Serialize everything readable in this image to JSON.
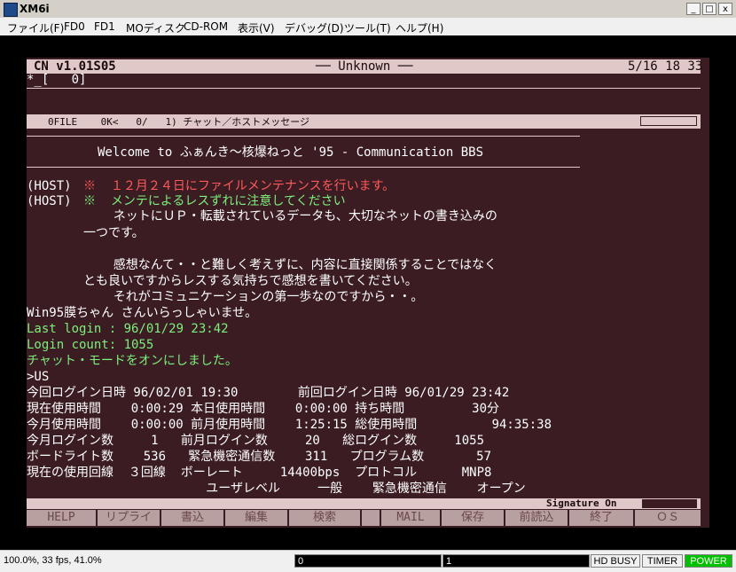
{
  "window": {
    "title": "XM6i",
    "min_label": "_",
    "max_label": "□",
    "close_label": "x"
  },
  "menu": [
    "ファイル(F)",
    "FD0",
    "FD1",
    "MOディスク",
    "CD-ROM",
    "表示(V)",
    "デバッグ(D)",
    "ツール(T)",
    "ヘルプ(H)"
  ],
  "term": {
    "header_left": "CN v1.01S05",
    "header_center": "── Unknown ──",
    "header_right": "5/16 18 33",
    "input_line": "*_[   0]",
    "bar2_items": "0FILE    0K<   0/   1) チャット／ホストメッセージ",
    "welcome": "Welcome to ふぁんき〜核爆ねっと '95 - Communication BBS",
    "host1_tag": "(HOST)",
    "host1_msg": "※  １２月２４日にファイルメンテナンスを行います。",
    "host2_tag": "(HOST)",
    "host2_msg": "※  メンテによるレスずれに注意してください",
    "body": [
      "    ネットにＵＰ・転載されているデータも、大切なネットの書き込みの",
      "一つです。",
      "",
      "    感想なんて・・と難しく考えずに、内容に直接関係することではなく",
      "とも良いですからレスする気持ちで感想を書いてください。",
      "    それがコミュニケーションの第一歩なのですから・・。"
    ],
    "greeting": "Win95膜ちゃん さんいらっしゃいませ。",
    "last_login": "Last login : 96/01/29 23:42",
    "login_count": "Login count: 1055",
    "chat_on": "チャット・モードをオンにしました。",
    "command": ">US",
    "stats": [
      "今回ログイン日時 96/02/01 19:30        前回ログイン日時 96/01/29 23:42",
      "現在使用時間    0:00:29 本日使用時間    0:00:00 持ち時間         30分",
      "今月使用時間    0:00:00 前月使用時間    1:25:15 総使用時間          94:35:38",
      "今月ログイン数     1   前月ログイン数     20   総ログイン数     1055",
      "ボードライト数    536   緊急機密通信数    311   プログラム数       57",
      "現在の使用回線  ３回線  ボーレート     14400bps  プロトコル      MNP8",
      "                        ユーザレベル     一般    緊急機密通信    オープン"
    ],
    "signature": "Signature On",
    "fkeys": [
      "HELP",
      "リプライ",
      "書込",
      "編集",
      "検索",
      "",
      "MAIL",
      "保存",
      "前読込",
      "終了",
      "ＯＳ"
    ]
  },
  "status": {
    "speed": "100.0%, 33 fps, 41.0%",
    "drive0": "0",
    "drive1": "1",
    "hd_busy": "HD BUSY",
    "timer": "TIMER",
    "power": "POWER"
  },
  "colors": {
    "terminal_bg": "#3a1c22",
    "host_red": "#ff5a5a",
    "host_green": "#7cf07c",
    "power_green": "#00c000"
  }
}
